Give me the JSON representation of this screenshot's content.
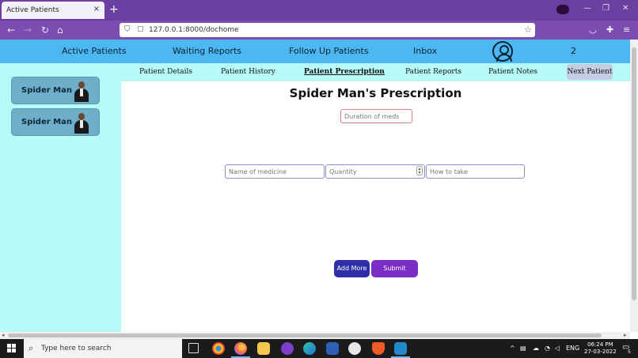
{
  "browser": {
    "tab_title": "Active Patients",
    "tab_close": "×",
    "new_tab": "+",
    "url": "127.0.0.1:8000/dochome",
    "min": "—",
    "restore": "❐",
    "close": "✕",
    "back": "←",
    "forward": "→",
    "reload": "↻",
    "home": "⌂",
    "star": "☆",
    "pocket": "◡",
    "extensions": "✚",
    "menu": "≡"
  },
  "header": {
    "nav": [
      "Active Patients",
      "Waiting Reports",
      "Follow Up Patients",
      "Inbox"
    ],
    "count": "2"
  },
  "sidebar": {
    "patients": [
      {
        "name": "Spider Man"
      },
      {
        "name": "Spider Man"
      }
    ]
  },
  "subtabs": {
    "items": [
      "Patient Details",
      "Patient History",
      "Patient Prescription",
      "Patient Reports",
      "Patient Notes"
    ],
    "active": "Patient Prescription",
    "next": "Next Patient"
  },
  "prescription": {
    "title": "Spider Man's Prescription",
    "duration_placeholder": "Duration of meds",
    "medicine_placeholder": "Name of medicine",
    "quantity_placeholder": "Quantity",
    "howto_placeholder": "How to take",
    "add_more": "Add More",
    "submit": "Submit"
  },
  "taskbar": {
    "search_placeholder": "Type here to search",
    "lang": "ENG",
    "time": "06:24 PM",
    "date": "27-03-2022",
    "notif_count": "5"
  },
  "colors": {
    "header_bg": "#4bb8f2",
    "sidebar_bg": "#b6fbf7",
    "card_bg": "#6faec9",
    "add_btn": "#2e2ea8",
    "submit_btn": "#7a2ec5",
    "browser_purple": "#6b3fa0"
  }
}
